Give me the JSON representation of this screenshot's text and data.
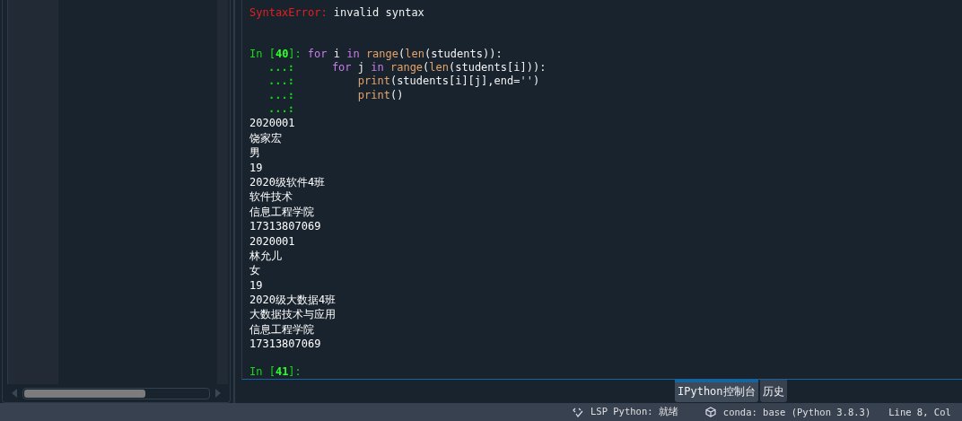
{
  "error": {
    "type": "SyntaxError:",
    "message": "invalid syntax"
  },
  "cell": {
    "prompt_label": "In [",
    "prompt_number": "40",
    "prompt_end": "]:",
    "lines": [
      {
        "segments": [
          {
            "kind": "keyword",
            "text": "for"
          },
          {
            "kind": "plain",
            "text": " i "
          },
          {
            "kind": "keyword",
            "text": "in "
          },
          {
            "kind": "builtin",
            "text": "range"
          },
          {
            "kind": "plain",
            "text": "("
          },
          {
            "kind": "builtin",
            "text": "len"
          },
          {
            "kind": "plain",
            "text": "(students)):"
          }
        ]
      },
      {
        "prompt": "...:",
        "segments": [
          {
            "kind": "keyword",
            "text": "    for"
          },
          {
            "kind": "plain",
            "text": " j "
          },
          {
            "kind": "keyword",
            "text": "in "
          },
          {
            "kind": "builtin",
            "text": "range"
          },
          {
            "kind": "plain",
            "text": "("
          },
          {
            "kind": "builtin",
            "text": "len"
          },
          {
            "kind": "plain",
            "text": "(students[i])):"
          }
        ]
      },
      {
        "prompt": "...:",
        "segments": [
          {
            "kind": "builtin",
            "text": "        print"
          },
          {
            "kind": "plain",
            "text": "(students[i][j],end="
          },
          {
            "kind": "string",
            "text": "''"
          },
          {
            "kind": "plain",
            "text": ")"
          }
        ]
      },
      {
        "prompt": "...:",
        "segments": [
          {
            "kind": "builtin",
            "text": "        print"
          },
          {
            "kind": "plain",
            "text": "()"
          }
        ]
      },
      {
        "prompt": "...:"
      }
    ]
  },
  "output": [
    "2020001",
    "饶家宏",
    "男",
    "19",
    "2020级软件4班",
    "软件技术",
    "信息工程学院",
    "17313807069",
    "2020001",
    "林允儿",
    "女",
    "19",
    "2020级大数据4班",
    "大数据技术与应用",
    "信息工程学院",
    "17313807069"
  ],
  "next_prompt": {
    "label": "In [",
    "number": "41",
    "end": "]:"
  },
  "tabs": [
    {
      "label": "IPython控制台",
      "selected": true
    },
    {
      "label": "历史",
      "selected": false
    }
  ],
  "status_bar": {
    "lsp": "LSP Python: 就绪",
    "conda": "conda: base (Python 3.8.3)",
    "position": "Line 8, Col"
  }
}
